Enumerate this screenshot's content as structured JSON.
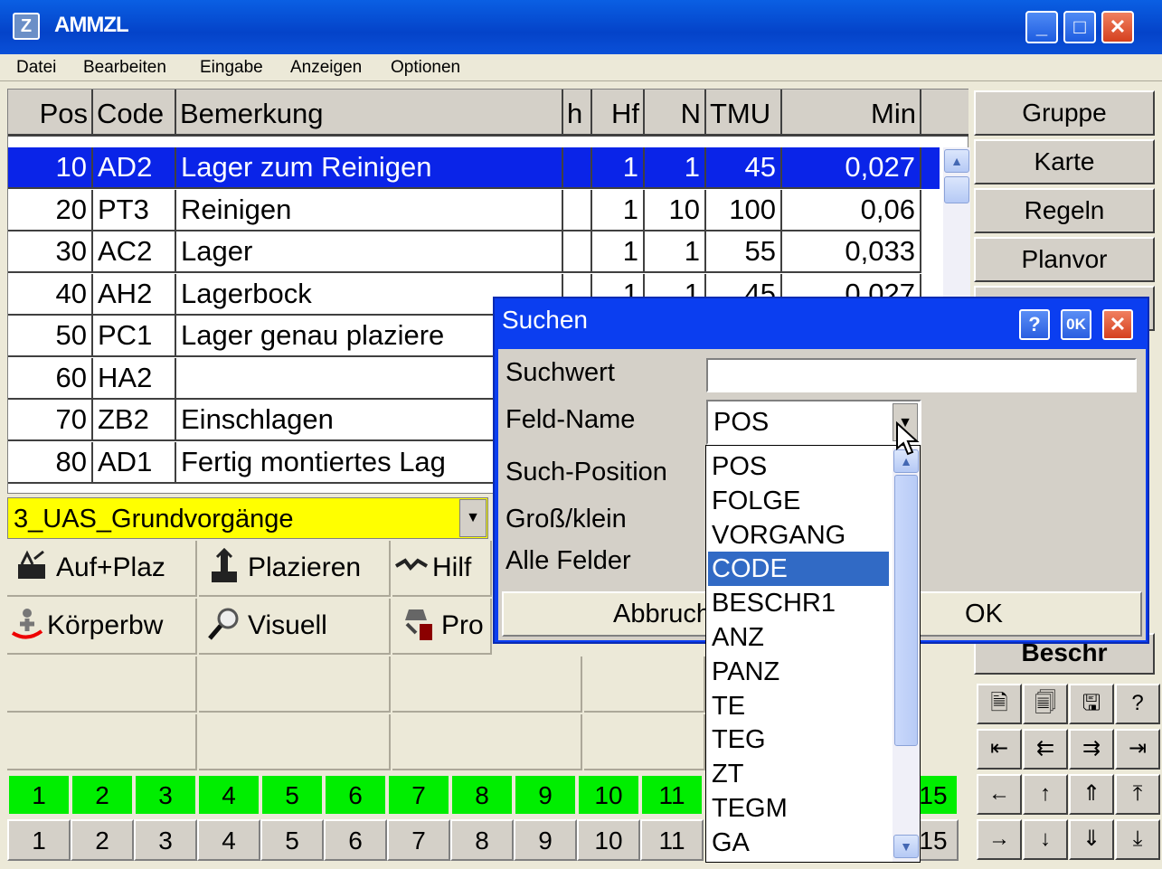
{
  "window": {
    "title": "AMMZL",
    "icon": "app-icon",
    "buttons": {
      "minimize": "_",
      "maximize": "□",
      "close": "✕"
    }
  },
  "menu": [
    "Datei",
    "Bearbeiten",
    "Eingabe",
    "Anzeigen",
    "Optionen"
  ],
  "table": {
    "headers": [
      "Pos",
      "Code",
      "Bemerkung",
      "h",
      "Hf",
      "N",
      "TMU",
      "Min"
    ],
    "rows": [
      [
        "10",
        "AD2",
        "Lager zum Reinigen",
        "",
        "1",
        "1",
        "45",
        "0,027"
      ],
      [
        "20",
        "PT3",
        "Reinigen",
        "",
        "1",
        "10",
        "100",
        "0,06"
      ],
      [
        "30",
        "AC2",
        "Lager",
        "",
        "1",
        "1",
        "55",
        "0,033"
      ],
      [
        "40",
        "AH2",
        "Lagerbock",
        "",
        "1",
        "1",
        "45",
        "0,027"
      ],
      [
        "50",
        "PC1",
        "Lager genau plaziere",
        "",
        "",
        "",
        "",
        ""
      ],
      [
        "60",
        "HA2",
        "",
        "",
        "",
        "",
        "",
        ""
      ],
      [
        "70",
        "ZB2",
        "Einschlagen",
        "",
        "",
        "",
        "",
        ""
      ],
      [
        "80",
        "AD1",
        "Fertig montiertes Lag",
        "",
        "",
        "",
        "",
        ""
      ]
    ],
    "selected_row": 0
  },
  "right_buttons": [
    "Gruppe",
    "Karte",
    "Regeln",
    "Planvor",
    "Beschr"
  ],
  "category_combo": {
    "value": "3_UAS_Grundvorgänge"
  },
  "tools": [
    {
      "label": "Auf+Plaz",
      "icon": "pick-place-icon"
    },
    {
      "label": "Plazieren",
      "icon": "place-icon"
    },
    {
      "label": "Hilf",
      "icon": "helper-icon"
    },
    {
      "label": "Körperbw",
      "icon": "body-movement-icon"
    },
    {
      "label": "Visuell",
      "icon": "magnifier-icon"
    },
    {
      "label": "Pro",
      "icon": "process-icon"
    }
  ],
  "green_numbers": [
    "1",
    "2",
    "3",
    "4",
    "5",
    "6",
    "7",
    "8",
    "9",
    "10",
    "11",
    "15"
  ],
  "gray_numbers": [
    "1",
    "2",
    "3",
    "4",
    "5",
    "6",
    "7",
    "8",
    "9",
    "10",
    "11",
    "15"
  ],
  "nav_buttons": {
    "row1": [
      "🗎",
      "🗐",
      "🖫",
      "?"
    ],
    "row2": [
      "⇤",
      "⇇",
      "⇉",
      "⇥"
    ],
    "row3": [
      "←",
      "↑",
      "⇑",
      "⤒"
    ],
    "row4": [
      "→",
      "↓",
      "⇓",
      "⤓"
    ]
  },
  "dialog": {
    "title": "Suchen",
    "title_buttons": {
      "help": "?",
      "ok": "0K",
      "close": "✕"
    },
    "labels": [
      "Suchwert",
      "Feld-Name",
      "Such-Position",
      "Groß/klein",
      "Alle Felder"
    ],
    "search_value": "",
    "field_name": "POS",
    "cancel_label": "Abbruch",
    "ok_label": "OK",
    "options": [
      "POS",
      "FOLGE",
      "VORGANG",
      "CODE",
      "BESCHR1",
      "ANZ",
      "PANZ",
      "TE",
      "TEG",
      "ZT",
      "TEGM",
      "GA"
    ],
    "highlighted_option": "CODE"
  },
  "colors": {
    "selection": "#0a24e8",
    "combo_bg": "#ffff00",
    "green": "#00ee00",
    "dialog_title": "#0b3ef0",
    "highlight": "#316ac5"
  }
}
